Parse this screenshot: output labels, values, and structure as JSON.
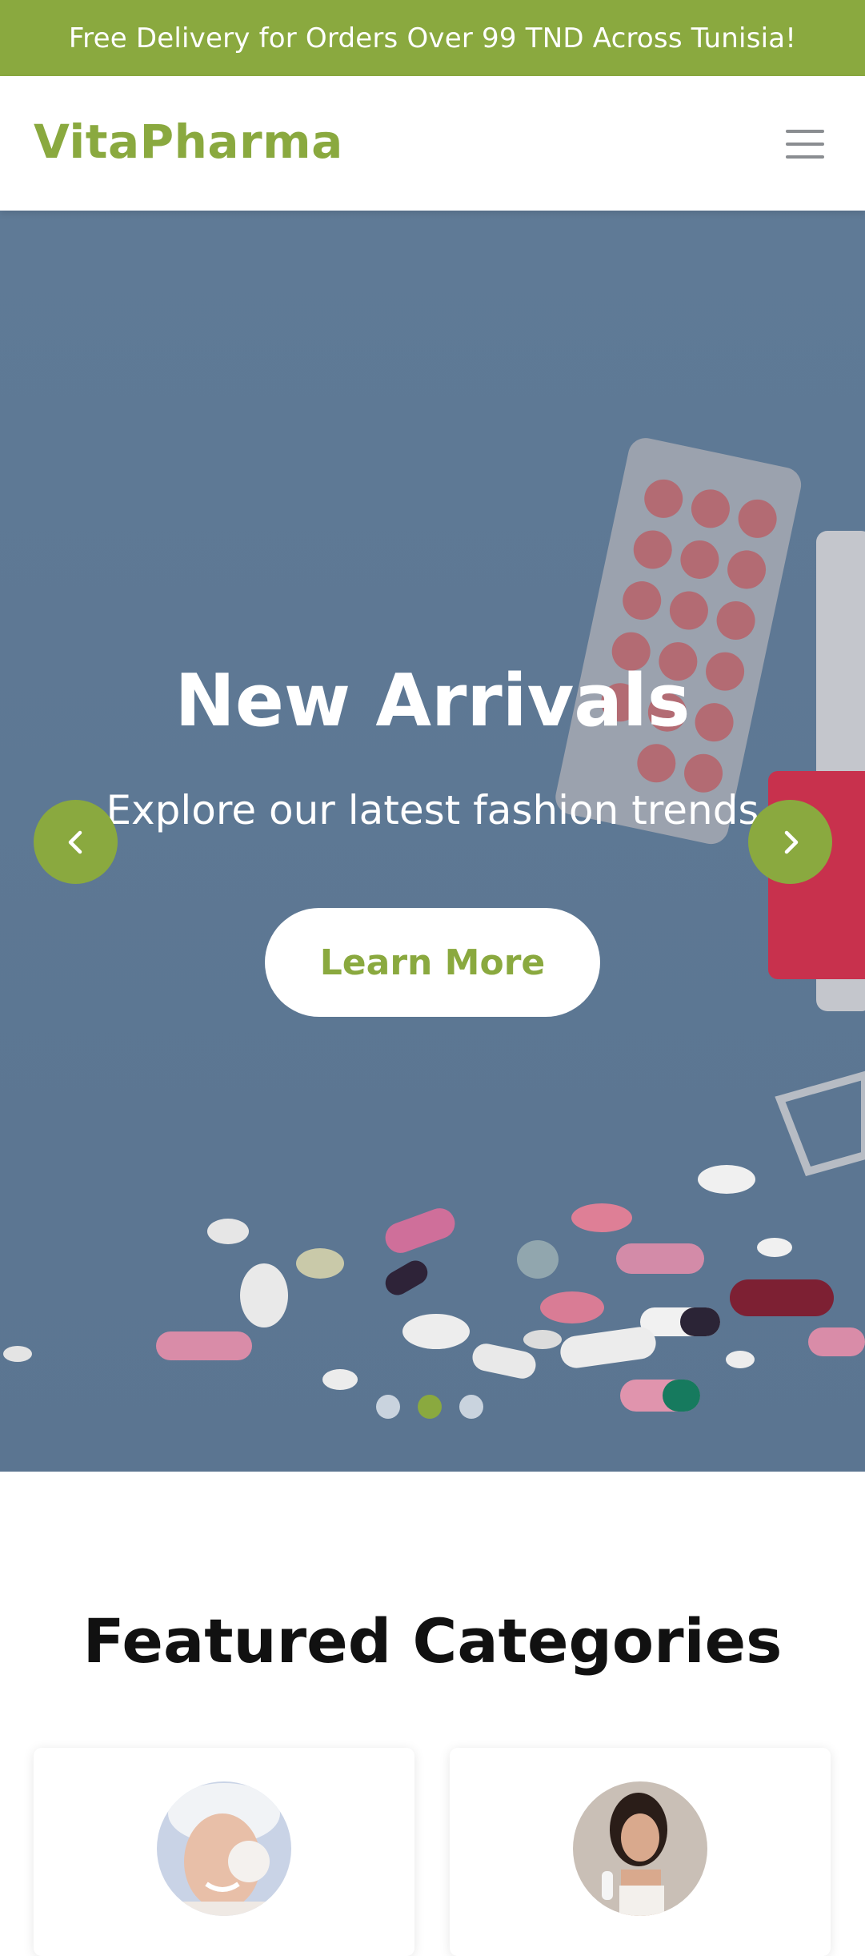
{
  "announcement": {
    "text": "Free Delivery for Orders Over 99 TND Across Tunisia!"
  },
  "header": {
    "brand": "VitaPharma",
    "menu_icon": "hamburger-menu-icon"
  },
  "hero": {
    "title": "New Arrivals",
    "subtitle": "Explore our latest fashion trends",
    "cta_label": "Learn More",
    "prev_icon": "chevron-left-icon",
    "next_icon": "chevron-right-icon",
    "slides": 3,
    "active_slide": 2
  },
  "featured": {
    "title": "Featured Categories",
    "categories": [
      {
        "image": "woman-skincare-cream-photo"
      },
      {
        "image": "woman-applying-lotion-photo"
      }
    ]
  },
  "colors": {
    "accent": "#8aa93f",
    "hero_bg": "#5e7894",
    "text_dark": "#111111",
    "menu_icon": "#8a8d91"
  }
}
